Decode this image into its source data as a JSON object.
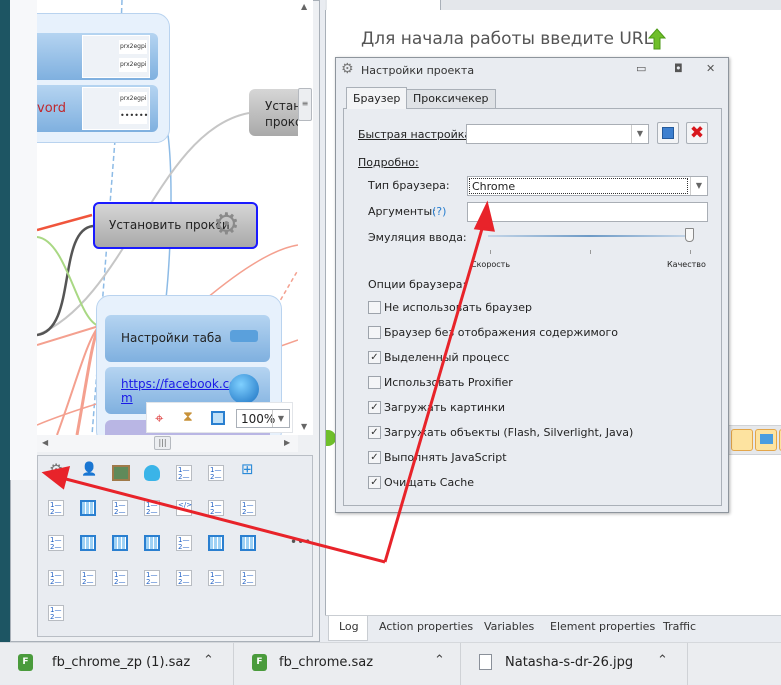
{
  "canvas": {
    "node_prx1": "prx2egpi",
    "node_prx2": "prx2egpi",
    "node_prx3": "prx2egpi",
    "node_pwd_mask": "••••••",
    "node_password_label": "vord",
    "node_set_proxy_right": "Устан\nпрокс",
    "node_set_proxy_right_line1": "Устан",
    "node_set_proxy_right_line2": "прокс",
    "node_set_proxy": "Установить прокси",
    "node_tab_settings": "Настройки таба",
    "node_url_line1": "https://facebook.co",
    "node_url_line2": "m",
    "zoom_value": "100%"
  },
  "toolbox": {
    "more": "•••",
    "icons": [
      "gear",
      "user",
      "board",
      "bug",
      "list",
      "list",
      "sitemap",
      "list",
      "grid",
      "list",
      "list",
      "code",
      "list",
      "list",
      "list",
      "grid",
      "grid",
      "grid",
      "list",
      "grid",
      "grid",
      "list",
      "list",
      "list",
      "list",
      "list",
      "list",
      "list",
      "list"
    ]
  },
  "browser": {
    "hint": "Для начала работы введите URL"
  },
  "dialog": {
    "title": "Настройки проекта",
    "tabs": [
      "Браузер",
      "Проксичекер"
    ],
    "quick_setup_label": "Быстрая настройка:",
    "quick_setup_value": "",
    "details_label": "Подробно:",
    "browser_type_label": "Тип браузера:",
    "browser_type_value": "Chrome",
    "args_label": "Аргументы:",
    "args_help": "(?)",
    "args_value": "",
    "emulation_label": "Эмуляция ввода:",
    "slider_min": "Скорость",
    "slider_max": "Качество",
    "slider_value": 1.0,
    "options_label": "Опции браузера:",
    "options": [
      {
        "label": "Не использовать браузер",
        "checked": false
      },
      {
        "label": "Браузер без отображения содержимого",
        "checked": false
      },
      {
        "label": "Выделенный процесс",
        "checked": true
      },
      {
        "label": "Использовать Proxifier",
        "checked": false
      },
      {
        "label": "Загружать картинки",
        "checked": true
      },
      {
        "label": "Загружать объекты (Flash, Silverlight, Java)",
        "checked": true
      },
      {
        "label": "Выполнять JavaScript",
        "checked": true
      },
      {
        "label": "Очищать Cache",
        "checked": true
      }
    ]
  },
  "bottom_tabs": [
    "Log",
    "Action properties",
    "Variables",
    "Element properties",
    "Traffic"
  ],
  "downloads": [
    {
      "name": "fb_chrome_zp (1).saz",
      "icon": "F"
    },
    {
      "name": "fb_chrome.saz",
      "icon": "F"
    },
    {
      "name": "Natasha-s-dr-26.jpg",
      "icon": "img"
    }
  ],
  "colors": {
    "annotation_arrow": "#e8232a",
    "node_blue": "#8fbbe6",
    "selected_border": "#1a1aff"
  }
}
